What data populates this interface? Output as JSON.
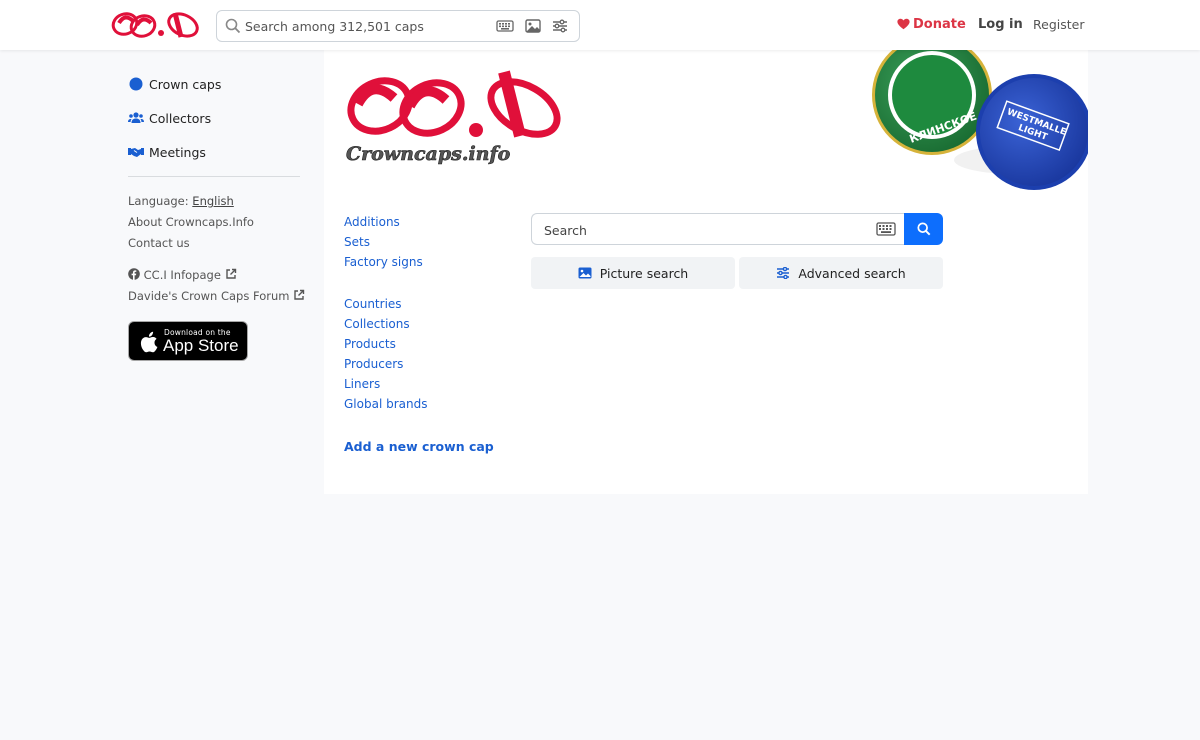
{
  "header": {
    "search_placeholder": "Search among 312,501 caps",
    "donate_label": "Donate",
    "login_label": "Log in",
    "register_label": "Register"
  },
  "sidebar": {
    "nav": [
      {
        "label": "Crown caps",
        "icon": "circle-icon"
      },
      {
        "label": "Collectors",
        "icon": "users-icon"
      },
      {
        "label": "Meetings",
        "icon": "handshake-icon"
      }
    ],
    "language_prefix": "Language:",
    "language_value": "English",
    "about_label": "About Crowncaps.Info",
    "contact_label": "Contact us",
    "infopage_label": "CC.I Infopage",
    "forum_label": "Davide's Crown Caps Forum",
    "appstore_small": "Download on the",
    "appstore_big": "App Store"
  },
  "main": {
    "links_group1": [
      "Additions",
      "Sets",
      "Factory signs"
    ],
    "links_group2": [
      "Countries",
      "Collections",
      "Products",
      "Producers",
      "Liners",
      "Global brands"
    ],
    "add_cap_label": "Add a new crown cap",
    "search_placeholder": "Search",
    "picture_search_label": "Picture search",
    "advanced_search_label": "Advanced search",
    "logo_tagline": "Crowncaps.info",
    "cap1_text": "КЛИНСКОЕ",
    "cap2_text_line1": "WESTMALLE",
    "cap2_text_line2": "LIGHT"
  },
  "colors": {
    "accent": "#0d6efd",
    "link": "#1a5fd1",
    "donate": "#dc3545",
    "logo_red": "#e0103a"
  }
}
